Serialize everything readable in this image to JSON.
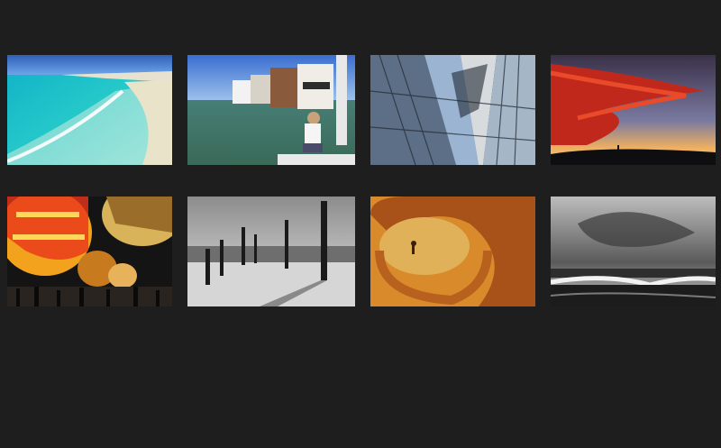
{
  "gallery": {
    "thumbnails": [
      {
        "subject": "tropical-beach"
      },
      {
        "subject": "seaside-village-child"
      },
      {
        "subject": "glass-architecture"
      },
      {
        "subject": "red-sunset-clouds"
      },
      {
        "subject": "hot-air-balloons-night"
      },
      {
        "subject": "pier-posts-beach-bw"
      },
      {
        "subject": "orange-spiral-sculpture"
      },
      {
        "subject": "stormy-sea-bw"
      }
    ]
  }
}
